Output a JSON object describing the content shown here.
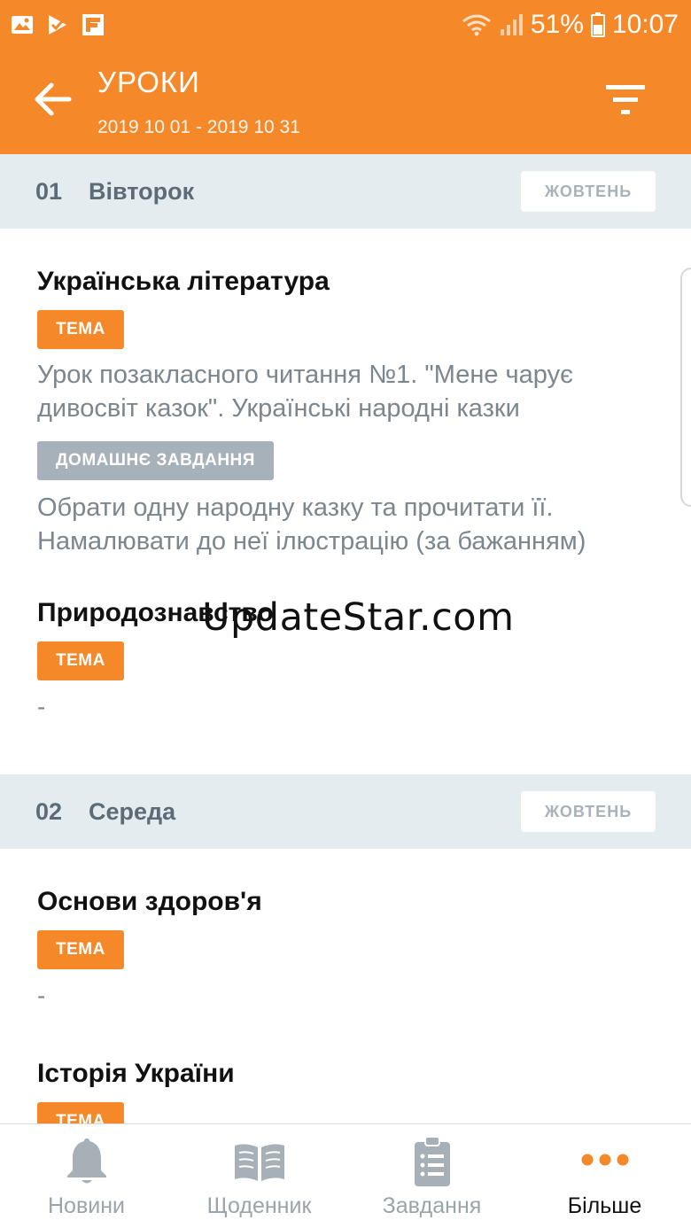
{
  "status_bar": {
    "battery": "51%",
    "time": "10:07",
    "icons_left": [
      "gallery-icon",
      "play-check-icon",
      "flipboard-icon"
    ],
    "icons_right": [
      "wifi-icon",
      "signal-icon",
      "battery-icon"
    ]
  },
  "header": {
    "title": "УРОКИ",
    "date_range": "2019 10 01 - 2019 10 31",
    "back_icon": "back-arrow-icon",
    "filter_icon": "filter-icon"
  },
  "days": [
    {
      "number": "01",
      "name": "Вівторок",
      "month": "ЖОВТЕНЬ",
      "lessons": [
        {
          "subject": "Українська література",
          "topic_label": "ТЕМА",
          "topic": "Урок позакласного читання №1. \"Мене чарує дивосвіт казок\". Українські народні казки",
          "homework_label": "ДОМАШНЄ ЗАВДАННЯ",
          "homework": "Обрати одну народну казку та прочитати її. Намалювати до неї ілюстрацію (за бажанням)"
        },
        {
          "subject": "Природознавство",
          "topic_label": "ТЕМА",
          "topic": "-"
        }
      ]
    },
    {
      "number": "02",
      "name": "Середа",
      "month": "ЖОВТЕНЬ",
      "lessons": [
        {
          "subject": "Основи здоров'я",
          "topic_label": "ТЕМА",
          "topic": "-"
        },
        {
          "subject": "Історія України",
          "topic_label": "ТЕМА"
        }
      ]
    }
  ],
  "watermark": "UpdateStar.com",
  "nav": [
    {
      "label": "Новини",
      "icon": "bell-icon",
      "active": false
    },
    {
      "label": "Щоденник",
      "icon": "book-icon",
      "active": false
    },
    {
      "label": "Завдання",
      "icon": "clipboard-icon",
      "active": false
    },
    {
      "label": "Більше",
      "icon": "more-dots-icon",
      "active": true
    }
  ],
  "colors": {
    "accent": "#f5892a",
    "day_header_bg": "#e5ecf0",
    "secondary_text": "#7c868e",
    "tag_grey": "#a6b1b9"
  }
}
